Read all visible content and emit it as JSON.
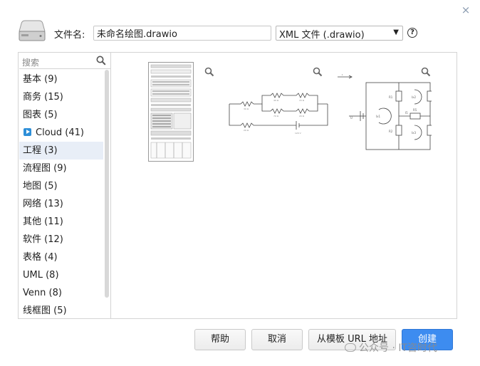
{
  "dialog": {
    "close_glyph": "×"
  },
  "filename": {
    "label": "文件名:",
    "value": "未命名绘图.drawio"
  },
  "format": {
    "selected": "XML 文件 (.drawio)"
  },
  "help_glyph": "?",
  "search": {
    "placeholder": "搜索"
  },
  "categories": [
    {
      "label": "基本 (9)"
    },
    {
      "label": "商务 (15)"
    },
    {
      "label": "图表 (5)"
    },
    {
      "label": "Cloud (41)",
      "badge": "play-icon"
    },
    {
      "label": "工程 (3)",
      "active": true
    },
    {
      "label": "流程图 (9)"
    },
    {
      "label": "地图 (5)"
    },
    {
      "label": "网络 (13)"
    },
    {
      "label": "其他 (11)"
    },
    {
      "label": "软件 (12)"
    },
    {
      "label": "表格 (4)"
    },
    {
      "label": "UML (8)"
    },
    {
      "label": "Venn (8)"
    },
    {
      "label": "线框图 (5)"
    }
  ],
  "buttons": {
    "help": "帮助",
    "cancel": "取消",
    "from_url": "从模板 URL 地址",
    "create": "创建"
  },
  "watermark": "公众号 · IT咨时代",
  "colors": {
    "accent": "#3d8cf0",
    "active_row": "#e8eef7",
    "cloud_badge": "#2e8fd8"
  }
}
